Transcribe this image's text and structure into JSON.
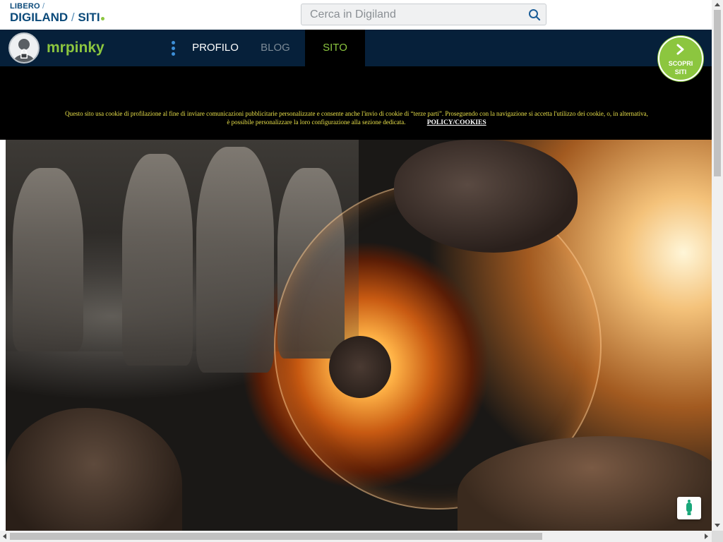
{
  "logo": {
    "top_text": "LIBERO",
    "top_slash": "/",
    "brand": "DIGILAND",
    "brand_slash": "/",
    "section": "SITI"
  },
  "search": {
    "placeholder": "Cerca in Digiland",
    "value": "",
    "icon": "search-icon"
  },
  "profile": {
    "username": "mrpinky",
    "avatar_icon": "user-lock-icon"
  },
  "nav": {
    "menu_icon": "kebab-menu-icon",
    "tabs": [
      {
        "label": "PROFILO",
        "active": false
      },
      {
        "label": "BLOG",
        "active": false
      },
      {
        "label": "SITO",
        "active": true
      }
    ]
  },
  "scopri": {
    "line1": "SCOPRI",
    "line2": "SITI",
    "icon": "chevron-right-icon"
  },
  "cookie_notice": {
    "text": "Questo sito usa cookie di profilazione al fine di inviare comunicazioni pubblicitarie personalizzate e consente anche l'invio di cookie di “terze parti”. Proseguendo con la navigazione si accetta l'utilizzo dei cookie, o, in alternativa, è possibile personalizzare la loro configurazione alla sezione dedicata.",
    "link_label": "POLICY/COOKIES"
  },
  "feedback": {
    "icon": "feedback-icon"
  },
  "colors": {
    "accent_green": "#8cc63f",
    "navy": "#06203a",
    "logo_blue": "#0b4a7a",
    "cookie_yellow": "#e8e04a"
  }
}
